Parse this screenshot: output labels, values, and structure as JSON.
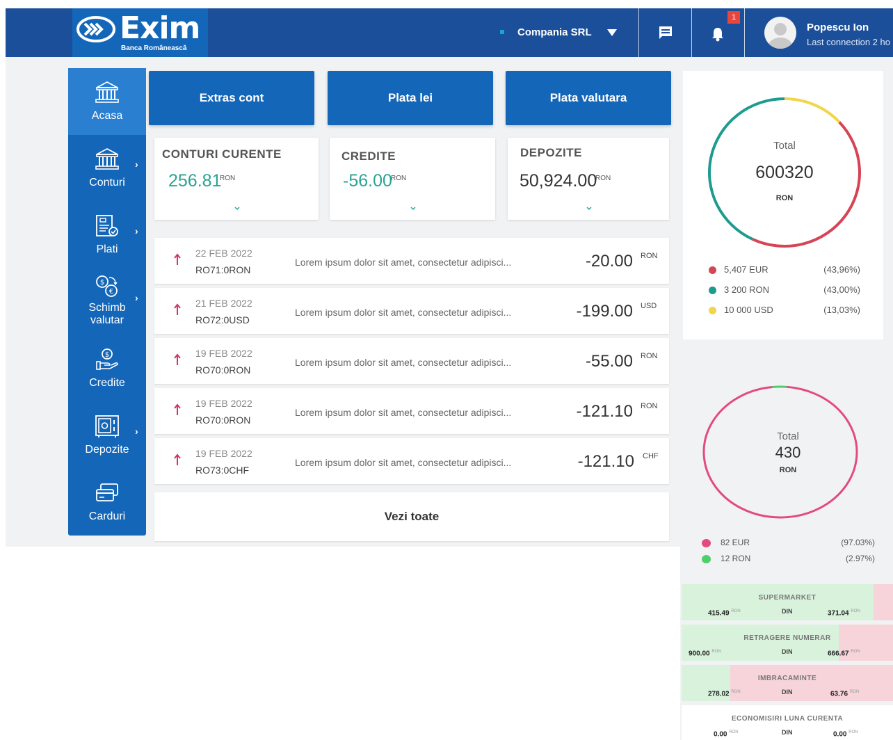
{
  "brand": {
    "name": "Exim",
    "tagline": "Banca Românească"
  },
  "header": {
    "company": "Compania SRL",
    "notifications_badge": "1",
    "user_name": "Popescu Ion",
    "last_connection": "Last connection 2 ho"
  },
  "sidebar": {
    "items": [
      {
        "label": "Acasa",
        "icon": "bank-icon",
        "active": true,
        "has_submenu": false
      },
      {
        "label": "Conturi",
        "icon": "bank-icon",
        "active": false,
        "has_submenu": true
      },
      {
        "label": "Plati",
        "icon": "invoice-icon",
        "active": false,
        "has_submenu": true
      },
      {
        "label": "Schimb valutar",
        "line1": "Schimb",
        "line2": "valutar",
        "icon": "currency-exchange-icon",
        "active": false,
        "has_submenu": true
      },
      {
        "label": "Credite",
        "icon": "coin-hand-icon",
        "active": false,
        "has_submenu": false
      },
      {
        "label": "Depozite",
        "icon": "safe-icon",
        "active": false,
        "has_submenu": true
      },
      {
        "label": "Carduri",
        "icon": "cards-icon",
        "active": false,
        "has_submenu": false
      }
    ]
  },
  "actions": {
    "extras": "Extras cont",
    "plata_lei": "Plata lei",
    "plata_valutara": "Plata valutara"
  },
  "summary": [
    {
      "title": "CONTURI CURENTE",
      "value": "256.81",
      "currency": "RON"
    },
    {
      "title": "CREDITE",
      "value": "-56.00",
      "currency": "RON"
    },
    {
      "title": "DEPOZITE",
      "value": "50,924.00",
      "currency": "RON"
    }
  ],
  "transactions": [
    {
      "date": "22 FEB 2022",
      "account": "RO71:0RON",
      "description": "Lorem ipsum dolor sit amet, consectetur adipisci...",
      "amount": "-20.00",
      "currency": "RON"
    },
    {
      "date": "21 FEB 2022",
      "account": "RO72:0USD",
      "description": "Lorem ipsum dolor sit amet, consectetur adipisci...",
      "amount": "-199.00",
      "currency": "USD"
    },
    {
      "date": "19 FEB 2022",
      "account": "RO70:0RON",
      "description": "Lorem ipsum dolor sit amet, consectetur adipisci...",
      "amount": "-55.00",
      "currency": "RON"
    },
    {
      "date": "19 FEB 2022",
      "account": "RO70:0RON",
      "description": "Lorem ipsum dolor sit amet, consectetur adipisci...",
      "amount": "-121.10",
      "currency": "RON"
    },
    {
      "date": "19 FEB 2022",
      "account": "RO73:0CHF",
      "description": "Lorem ipsum dolor sit amet, consectetur adipisci...",
      "amount": "-121.10",
      "currency": "CHF"
    }
  ],
  "see_all": "Vezi toate",
  "colors": {
    "brand": "#1466b8",
    "header": "#1c4f9a",
    "positive": "#2aa394",
    "debit_arrow": "#d0356b"
  },
  "chart_data": [
    {
      "type": "pie",
      "center_label": "Total",
      "total": "600320",
      "currency": "RON",
      "slices": [
        {
          "label": "5,407 EUR",
          "pct_text": "(43,96%)",
          "value": 43.96,
          "color": "#d64456"
        },
        {
          "label": "3 200 RON",
          "pct_text": "(43,00%)",
          "value": 43.0,
          "color": "#1e9b8f"
        },
        {
          "label": "10 000 USD",
          "pct_text": "(13,03%)",
          "value": 13.03,
          "color": "#f1d54a"
        }
      ]
    },
    {
      "type": "pie",
      "center_label": "Total",
      "total": "430",
      "currency": "RON",
      "slices": [
        {
          "label": "82 EUR",
          "pct_text": "(97.03%)",
          "value": 97.03,
          "color": "#e34b7d"
        },
        {
          "label": "12 RON",
          "pct_text": "(2.97%)",
          "value": 2.97,
          "color": "#4fcf6a"
        }
      ]
    }
  ],
  "budget": [
    {
      "title": "SUPERMARKET",
      "spent": "415.49",
      "din": "DIN",
      "total": "371.04",
      "currency": "RON",
      "progress": 1.12
    },
    {
      "title": "RETRAGERE NUMERAR",
      "spent": "900.00",
      "din": "DIN",
      "total": "666.67",
      "currency": "RON",
      "progress": 1.35
    },
    {
      "title": "IMBRACAMINTE",
      "spent": "278.02",
      "din": "DIN",
      "total": "63.76",
      "currency": "RON",
      "progress": 4.36
    },
    {
      "title": "ECONOMISIRI LUNA CURENTA",
      "spent": "0.00",
      "din": "DIN",
      "total": "0.00",
      "currency": "RON",
      "progress": 0
    }
  ]
}
